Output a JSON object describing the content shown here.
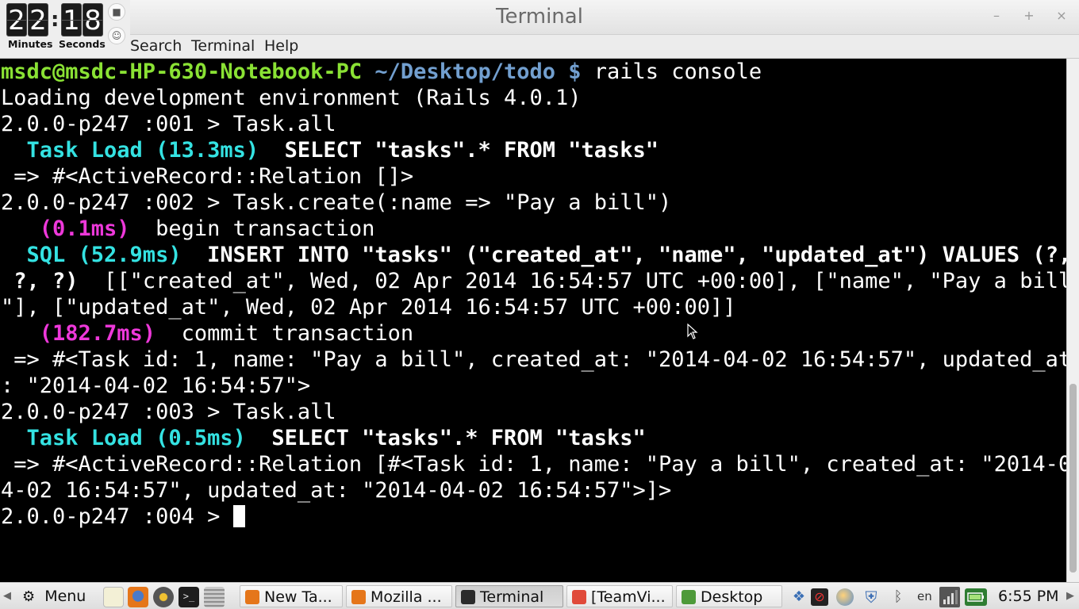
{
  "window": {
    "title": "Terminal"
  },
  "menu": {
    "items": [
      "Search",
      "Terminal",
      "Help"
    ]
  },
  "timer": {
    "minutes_digits": [
      "2",
      "2"
    ],
    "seconds_digits": [
      "1",
      "8"
    ],
    "separator": ":",
    "minutes_label": "Minutes",
    "seconds_label": "Seconds"
  },
  "terminal": {
    "lines": [
      [
        {
          "t": "msdc@msdc-HP-630-Notebook-PC",
          "s": "g"
        },
        {
          "t": " ~/Desktop/todo $",
          "s": "b"
        },
        {
          "t": " rails console",
          "s": ""
        }
      ],
      [
        {
          "t": "Loading development environment (Rails 4.0.1)",
          "s": ""
        }
      ],
      [
        {
          "t": "2.0.0-p247 :001 > Task.all",
          "s": ""
        }
      ],
      [
        {
          "t": "  Task Load (13.3ms)",
          "s": "c"
        },
        {
          "t": "  SELECT \"tasks\".* FROM \"tasks\"",
          "s": "w"
        }
      ],
      [
        {
          "t": " => #<ActiveRecord::Relation []>",
          "s": ""
        }
      ],
      [
        {
          "t": "2.0.0-p247 :002 > Task.create(:name => \"Pay a bill\")",
          "s": ""
        }
      ],
      [
        {
          "t": "   (0.1ms)",
          "s": "m"
        },
        {
          "t": "  begin transaction",
          "s": ""
        }
      ],
      [
        {
          "t": "  SQL (52.9ms)",
          "s": "c"
        },
        {
          "t": "  INSERT INTO \"tasks\" (\"created_at\", \"name\", \"updated_at\") VALUES (?,",
          "s": "w"
        }
      ],
      [
        {
          "t": " ?, ?)",
          "s": "w"
        },
        {
          "t": "  [[\"created_at\", Wed, 02 Apr 2014 16:54:57 UTC +00:00], [\"name\", \"Pay a bill",
          "s": ""
        }
      ],
      [
        {
          "t": "\"], [\"updated_at\", Wed, 02 Apr 2014 16:54:57 UTC +00:00]]",
          "s": ""
        }
      ],
      [
        {
          "t": "   (182.7ms)",
          "s": "m"
        },
        {
          "t": "  commit transaction",
          "s": ""
        }
      ],
      [
        {
          "t": " => #<Task id: 1, name: \"Pay a bill\", created_at: \"2014-04-02 16:54:57\", updated_at",
          "s": ""
        }
      ],
      [
        {
          "t": ": \"2014-04-02 16:54:57\">",
          "s": ""
        }
      ],
      [
        {
          "t": "2.0.0-p247 :003 > Task.all",
          "s": ""
        }
      ],
      [
        {
          "t": "  Task Load (0.5ms)",
          "s": "c"
        },
        {
          "t": "  SELECT \"tasks\".* FROM \"tasks\"",
          "s": "w"
        }
      ],
      [
        {
          "t": " => #<ActiveRecord::Relation [#<Task id: 1, name: \"Pay a bill\", created_at: \"2014-0",
          "s": ""
        }
      ],
      [
        {
          "t": "4-02 16:54:57\", updated_at: \"2014-04-02 16:54:57\">]>",
          "s": ""
        }
      ],
      [
        {
          "t": "2.0.0-p247 :004 > ",
          "s": ""
        }
      ]
    ]
  },
  "taskbar": {
    "menu_label": "Menu",
    "tasks": [
      {
        "label": "New Ta...",
        "icon": "firefox-icon",
        "color": "#e5761a"
      },
      {
        "label": "Mozilla ...",
        "icon": "firefox-icon",
        "color": "#e5761a"
      },
      {
        "label": "Terminal",
        "icon": "terminal-icon",
        "color": "#2b2b2b"
      },
      {
        "label": "[TeamVi...",
        "icon": "teamviewer-icon",
        "color": "#e04a3a"
      },
      {
        "label": "Desktop",
        "icon": "folder-icon",
        "color": "#4e9a3a"
      }
    ],
    "language": "en",
    "clock": "6:55 PM"
  },
  "colors": {
    "prompt_user": "#8ae234",
    "prompt_path": "#729fcf",
    "sql_load": "#34e2e2",
    "transaction": "#ee38da"
  }
}
